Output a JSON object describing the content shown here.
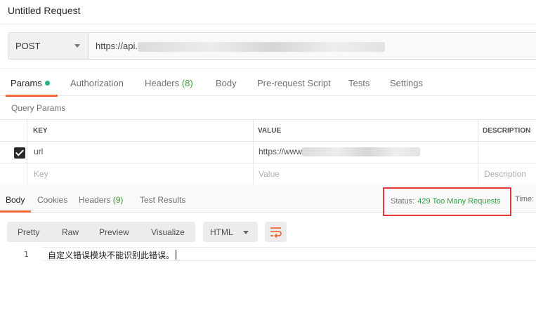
{
  "window": {
    "title": "Untitled Request"
  },
  "request": {
    "method": "POST",
    "url_visible": "https://api."
  },
  "request_tabs": [
    {
      "label": "Params",
      "active": true,
      "has_dot": true
    },
    {
      "label": "Authorization"
    },
    {
      "label": "Headers",
      "count": "(8)"
    },
    {
      "label": "Body"
    },
    {
      "label": "Pre-request Script"
    },
    {
      "label": "Tests"
    },
    {
      "label": "Settings"
    }
  ],
  "params": {
    "section_label": "Query Params",
    "columns": [
      "KEY",
      "VALUE",
      "DESCRIPTION"
    ],
    "rows": [
      {
        "checked": true,
        "key": "url",
        "value": "https://www",
        "description": ""
      }
    ],
    "placeholders": {
      "key": "Key",
      "value": "Value",
      "description": "Description"
    }
  },
  "response_tabs": [
    {
      "label": "Body",
      "active": true
    },
    {
      "label": "Cookies"
    },
    {
      "label": "Headers",
      "count": "(9)"
    },
    {
      "label": "Test Results"
    }
  ],
  "status": {
    "label": "Status:",
    "value": "429 Too Many Requests",
    "time_label": "Time:"
  },
  "response_toolbar": {
    "views": [
      "Pretty",
      "Raw",
      "Preview",
      "Visualize"
    ],
    "language": "HTML",
    "wrap_icon": "wrap-lines-icon"
  },
  "response_body": {
    "lines": [
      {
        "number": "1",
        "text": "自定义错误模块不能识别此错误。"
      }
    ]
  },
  "colors": {
    "accent": "#f26b3a",
    "status_ok": "#2e9e44",
    "highlight_box": "#e53935",
    "dot": "#26b47f"
  }
}
